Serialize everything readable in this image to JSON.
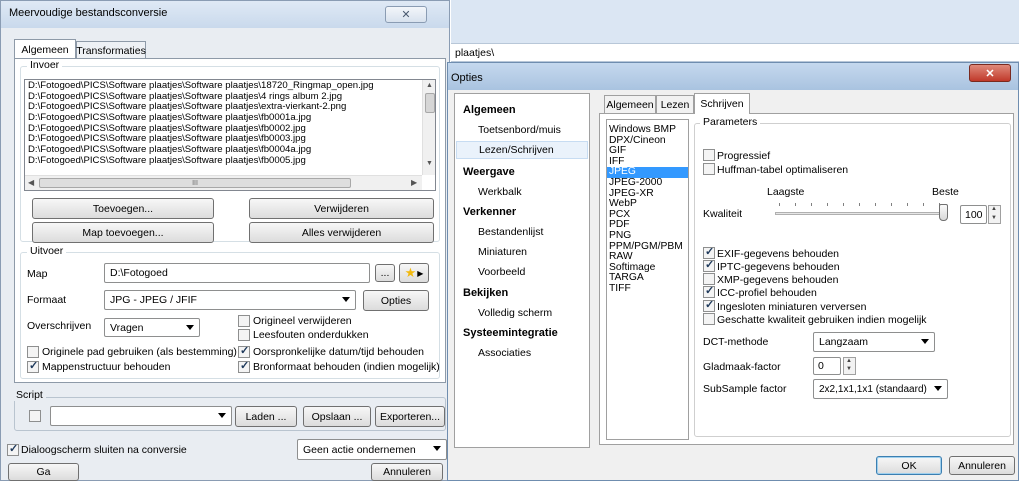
{
  "left": {
    "title": "Meervoudige bestandsconversie",
    "tabs": [
      "Algemeen",
      "Transformaties"
    ],
    "input": {
      "group": "Invoer",
      "files": [
        "D:\\Fotogoed\\PICS\\Software plaatjes\\Software plaatjes\\18720_Ringmap_open.jpg",
        "D:\\Fotogoed\\PICS\\Software plaatjes\\Software plaatjes\\4 rings album 2.jpg",
        "D:\\Fotogoed\\PICS\\Software plaatjes\\Software plaatjes\\extra-vierkant-2.png",
        "D:\\Fotogoed\\PICS\\Software plaatjes\\Software plaatjes\\fb0001a.jpg",
        "D:\\Fotogoed\\PICS\\Software plaatjes\\Software plaatjes\\fb0002.jpg",
        "D:\\Fotogoed\\PICS\\Software plaatjes\\Software plaatjes\\fb0003.jpg",
        "D:\\Fotogoed\\PICS\\Software plaatjes\\Software plaatjes\\fb0004a.jpg",
        "D:\\Fotogoed\\PICS\\Software plaatjes\\Software plaatjes\\fb0005.jpg"
      ],
      "hscroll_grip": "III",
      "add": "Toevoegen...",
      "remove": "Verwijderen",
      "add_folder": "Map toevoegen...",
      "remove_all": "Alles verwijderen"
    },
    "output": {
      "group": "Uitvoer",
      "folder_label": "Map",
      "folder_value": "D:\\Fotogoed",
      "browse": "...",
      "format_label": "Formaat",
      "format_value": "JPG - JPEG / JFIF",
      "options": "Opties",
      "overwrite_label": "Overschrijven",
      "overwrite_value": "Vragen",
      "cb_delete_original": "Origineel verwijderen",
      "cb_suppress_errors": "Leesfouten onderdukken",
      "cb_original_path": "Originele pad gebruiken (als bestemming)",
      "cb_keep_date": "Oorspronkelijke datum/tijd behouden",
      "cb_keep_folders": "Mappenstructuur behouden",
      "cb_keep_source_format": "Bronformaat behouden (indien mogelijk)"
    },
    "script": {
      "group": "Script",
      "load": "Laden ...",
      "save": "Opslaan ...",
      "export": "Exporteren..."
    },
    "close_after": "Dialoogscherm sluiten na conversie",
    "after_action": "Geen actie ondernemen",
    "go": "Ga",
    "cancel": "Annuleren"
  },
  "bg": {
    "path_fragment": "plaatjes\\"
  },
  "right": {
    "title": "Opties",
    "nav": [
      {
        "label": "Algemeen",
        "header": true
      },
      {
        "label": "Toetsenbord/muis",
        "header": false
      },
      {
        "label": "Lezen/Schrijven",
        "header": false,
        "selected": true
      },
      {
        "label": "Weergave",
        "header": true
      },
      {
        "label": "Werkbalk",
        "header": false
      },
      {
        "label": "Verkenner",
        "header": true
      },
      {
        "label": "Bestandenlijst",
        "header": false
      },
      {
        "label": "Miniaturen",
        "header": false
      },
      {
        "label": "Voorbeeld",
        "header": false
      },
      {
        "label": "Bekijken",
        "header": true
      },
      {
        "label": "Volledig scherm",
        "header": false
      },
      {
        "label": "Systeemintegratie",
        "header": true
      },
      {
        "label": "Associaties",
        "header": false
      }
    ],
    "tabs": [
      "Algemeen",
      "Lezen",
      "Schrijven"
    ],
    "formats": [
      "Windows BMP",
      "DPX/Cineon",
      "GIF",
      "IFF",
      "JPEG",
      "JPEG-2000",
      "JPEG-XR",
      "WebP",
      "PCX",
      "PDF",
      "PNG",
      "PPM/PGM/PBM",
      "RAW",
      "Softimage",
      "TARGA",
      "TIFF"
    ],
    "selected_format": "JPEG",
    "params": {
      "group": "Parameters",
      "progressive": "Progressief",
      "huffman": "Huffman-tabel optimaliseren",
      "lowest": "Laagste",
      "best": "Beste",
      "quality_label": "Kwaliteit",
      "quality_value": "100",
      "quality_percent": 100,
      "exif": "EXIF-gegevens behouden",
      "iptc": "IPTC-gegevens behouden",
      "xmp": "XMP-gegevens behouden",
      "icc": "ICC-profiel behouden",
      "thumbs": "Ingesloten miniaturen verversen",
      "estimated": "Geschatte kwaliteit gebruiken indien mogelijk",
      "dct_label": "DCT-methode",
      "dct_value": "Langzaam",
      "smooth_label": "Gladmaak-factor",
      "smooth_value": "0",
      "subsample_label": "SubSample factor",
      "subsample_value": "2x2,1x1,1x1 (standaard)"
    },
    "ok": "OK",
    "cancel": "Annuleren"
  }
}
